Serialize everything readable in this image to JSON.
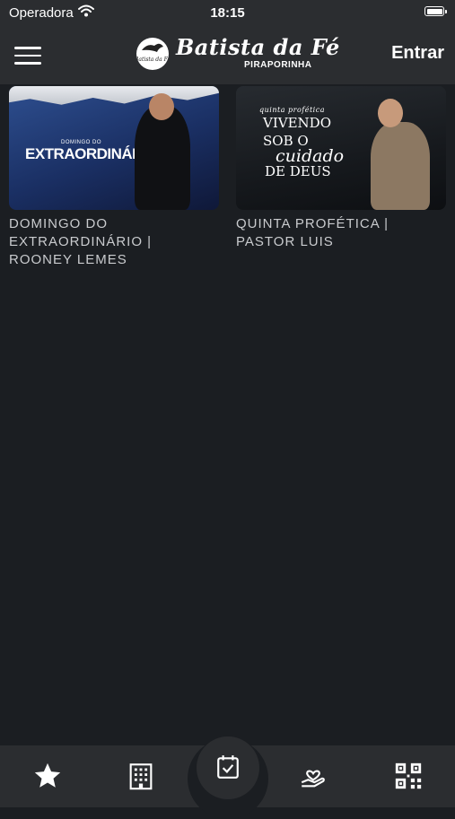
{
  "status_bar": {
    "carrier": "Operadora",
    "time": "18:15"
  },
  "header": {
    "logo_title": "Batista da Fé",
    "logo_subtitle": "PIRAPORINHA",
    "logo_mark_text": "Batista da Fé",
    "login_label": "Entrar"
  },
  "cards": [
    {
      "title": "DOMINGO DO\nEXTRAORDINÁRIO |\nROONEY LEMES",
      "thumb_small": "DOMINGO DO",
      "thumb_big": "EXTRAORDINÁRIO"
    },
    {
      "title": "QUINTA PROFÉTICA |\nPASTOR LUIS",
      "thumb_small": "quinta profética",
      "thumb_line1": "VIVENDO",
      "thumb_line2": "SOB O",
      "thumb_line3": "cuidado",
      "thumb_line4": "DE DEUS"
    }
  ],
  "bottom_nav": {
    "items": [
      "star-icon",
      "building-icon",
      "calendar-check-icon",
      "heart-hand-icon",
      "qr-code-icon"
    ],
    "active": "calendar-check-icon"
  },
  "colors": {
    "background": "#1b1e22",
    "bar": "#2b2d30",
    "text": "#ffffff",
    "muted_text": "#c9cbce"
  }
}
